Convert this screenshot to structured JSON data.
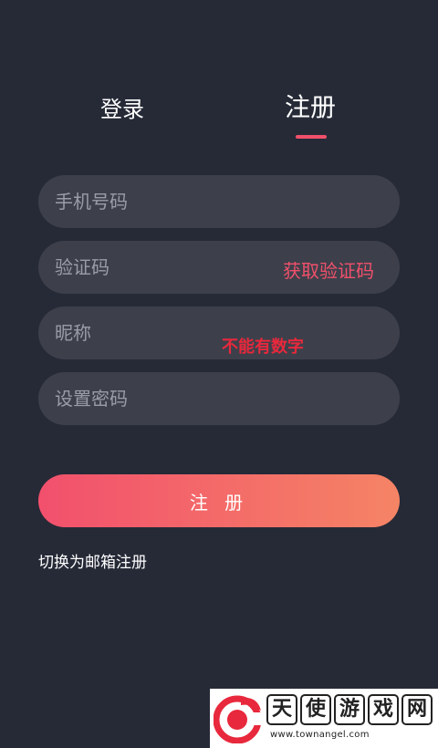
{
  "tabs": {
    "login": "登录",
    "register": "注册"
  },
  "form": {
    "phone_placeholder": "手机号码",
    "code_placeholder": "验证码",
    "get_code": "获取验证码",
    "nickname_placeholder": "昵称",
    "password_placeholder": "设置密码"
  },
  "annotation": "不能有数字",
  "submit_label": "注 册",
  "switch_link": "切换为邮箱注册",
  "watermark": {
    "chars": [
      "天",
      "使",
      "游",
      "戏",
      "网"
    ],
    "url": "www.townangel.com"
  },
  "colors": {
    "background": "#262a37",
    "field": "#3d404b",
    "accent": "#f0506b",
    "gradient_start": "#f2506d",
    "gradient_end": "#f58465"
  }
}
